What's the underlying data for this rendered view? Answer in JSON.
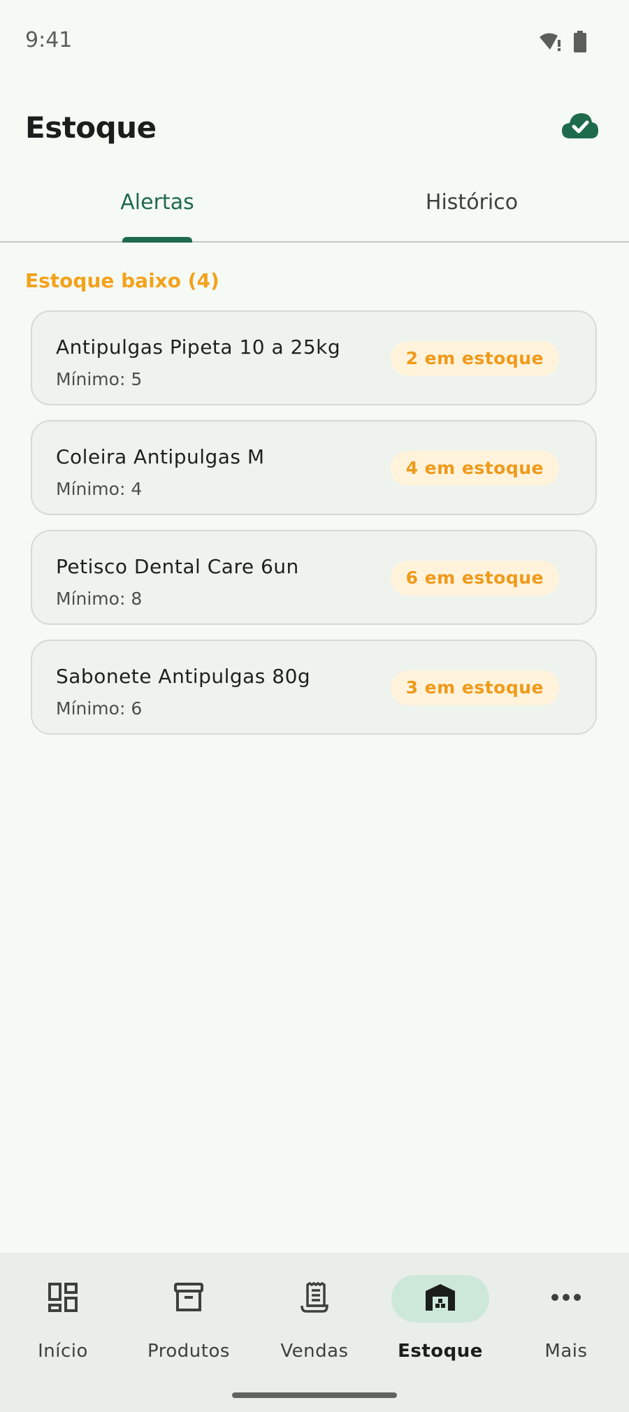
{
  "status_bar": {
    "time": "9:41"
  },
  "header": {
    "title": "Estoque"
  },
  "tabs": [
    {
      "label": "Alertas",
      "active": true
    },
    {
      "label": "Histórico",
      "active": false
    }
  ],
  "section": {
    "title": "Estoque baixo (4)"
  },
  "alerts": [
    {
      "name": "Antipulgas Pipeta 10 a 25kg",
      "minimum": "Mínimo: 5",
      "stock": "2 em estoque"
    },
    {
      "name": "Coleira Antipulgas M",
      "minimum": "Mínimo: 4",
      "stock": "4 em estoque"
    },
    {
      "name": "Petisco Dental Care 6un",
      "minimum": "Mínimo: 8",
      "stock": "6 em estoque"
    },
    {
      "name": "Sabonete Antipulgas 80g",
      "minimum": "Mínimo: 6",
      "stock": "3 em estoque"
    }
  ],
  "nav": [
    {
      "label": "Início",
      "icon": "dashboard-icon",
      "active": false
    },
    {
      "label": "Produtos",
      "icon": "archive-box-icon",
      "active": false
    },
    {
      "label": "Vendas",
      "icon": "receipt-icon",
      "active": false
    },
    {
      "label": "Estoque",
      "icon": "warehouse-icon",
      "active": true
    },
    {
      "label": "Mais",
      "icon": "more-horizontal-icon",
      "active": false
    }
  ],
  "colors": {
    "primary": "#1e6b4c",
    "warning": "#f3a21c",
    "badge_bg": "#fff3dc",
    "background": "#f6faf5"
  }
}
